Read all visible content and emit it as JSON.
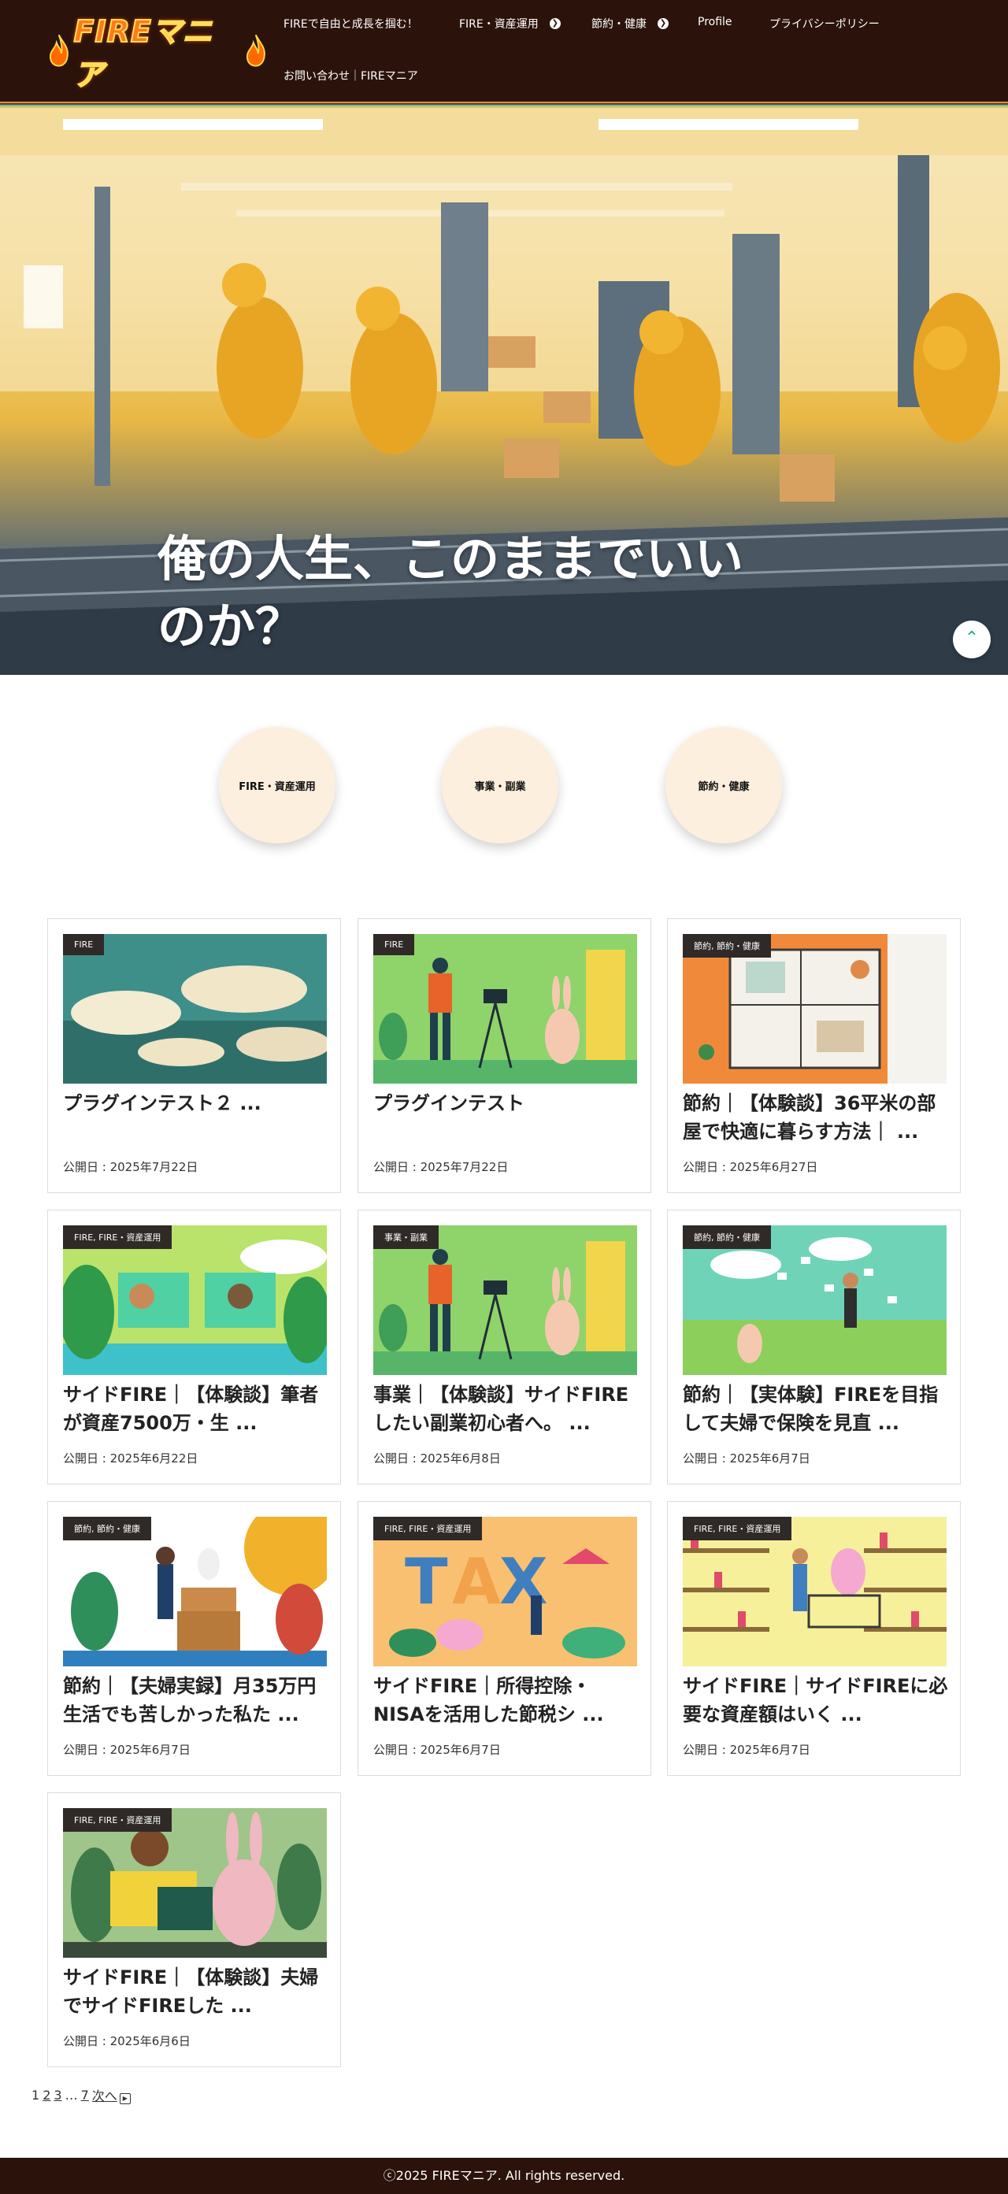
{
  "header": {
    "logo_text": "FIREマニア",
    "nav": [
      {
        "label": "FIREで自由と成長を掴む！"
      },
      {
        "label": "FIRE・資産運用"
      },
      {
        "label": "節約・健康"
      },
      {
        "label": "Profile"
      },
      {
        "label": "プライバシーポリシー"
      },
      {
        "label": "お問い合わせ｜FIREマニア"
      }
    ]
  },
  "hero": {
    "title": "俺の人生、このままでいいのか？",
    "scroll_icon": "chevron-up-icon"
  },
  "categories": [
    {
      "label": "FIRE・資産運用"
    },
    {
      "label": "事業・副業"
    },
    {
      "label": "節約・健康"
    }
  ],
  "posts": [
    {
      "category": "FIRE",
      "title": "プラグインテスト２ ...",
      "date": "公開日 : 2025年7月22日",
      "image": "clouds-sky-illustration"
    },
    {
      "category": "FIRE",
      "title": "プラグインテスト",
      "date": "公開日 : 2025年7月22日",
      "image": "camera-rabbit-illustration"
    },
    {
      "category": "節約, 節約・健康",
      "title": "節約｜【体験談】36平米の部屋で快適に暮らす方法｜ ...",
      "date": "公開日 : 2025年6月27日",
      "image": "floor-plan-illustration"
    },
    {
      "category": "FIRE, FIRE・資産運用",
      "title": "サイドFIRE｜【体験談】筆者が資産7500万・生 ...",
      "date": "公開日 : 2025年6月22日",
      "image": "jungle-computer-illustration"
    },
    {
      "category": "事業・副業",
      "title": "事業｜【体験談】サイドFIREしたい副業初心者へ。 ...",
      "date": "公開日 : 2025年6月8日",
      "image": "camera-rabbit-illustration"
    },
    {
      "category": "節約, 節約・健康",
      "title": "節約｜【実体験】FIREを目指して夫婦で保険を見直 ...",
      "date": "公開日 : 2025年6月7日",
      "image": "papers-field-illustration"
    },
    {
      "category": "節約, 節約・健康",
      "title": "節約｜【夫婦実録】月35万円生活でも苦しかった私た ...",
      "date": "公開日 : 2025年6月7日",
      "image": "boxes-rabbit-illustration"
    },
    {
      "category": "FIRE, FIRE・資産運用",
      "title": "サイドFIRE｜所得控除・NISAを活用した節税シ ...",
      "date": "公開日 : 2025年6月7日",
      "image": "tax-letters-illustration"
    },
    {
      "category": "FIRE, FIRE・資産運用",
      "title": "サイドFIRE｜サイドFIREに必要な資産額はいく ...",
      "date": "公開日 : 2025年6月7日",
      "image": "shopping-rabbit-illustration"
    },
    {
      "category": "FIRE, FIRE・資産運用",
      "title": "サイドFIRE｜【体験談】夫婦でサイドFIREした ...",
      "date": "公開日 : 2025年6月6日",
      "image": "reading-rabbit-illustration"
    }
  ],
  "pagination": {
    "pages": [
      "1",
      "2",
      "3"
    ],
    "ellipsis": "…",
    "last": "7",
    "next_label": "次へ"
  },
  "footer": {
    "copyright": "ⓒ2025 FIREマニア. All rights reserved."
  },
  "colors": {
    "header_bg": "#2b130b",
    "category_tag_bg": "#2f2a28",
    "circle_bg": "#fcefdd",
    "accent_green": "#1fae8f"
  }
}
